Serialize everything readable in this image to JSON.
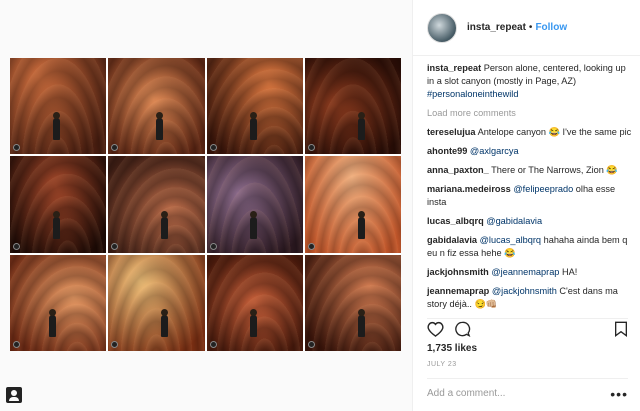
{
  "post": {
    "username": "insta_repeat",
    "dot": "•",
    "follow": "Follow",
    "caption_user": "insta_repeat",
    "caption_text": " Person alone, centered, looking up in a slot canyon (mostly in Page, AZ) ",
    "caption_tag": "#personaloneinthewild",
    "load_more": "Load more comments",
    "comments": [
      {
        "user": "tereselujua",
        "text": " Antelope canyon 😂 I've the same pic"
      },
      {
        "user": "ahonte99",
        "mention": "@axlgarcya",
        "text": ""
      },
      {
        "user": "anna_paxton_",
        "text": " There or The Narrows, Zion 😂"
      },
      {
        "user": "mariana.medeiross",
        "mention": "@felipeeprado",
        "text": " olha esse insta"
      },
      {
        "user": "lucas_albqrq",
        "mention": "@gabidalavia",
        "text": ""
      },
      {
        "user": "gabidalavia",
        "mention": "@lucas_albqrq",
        "text": " hahaha ainda bem q eu n fiz essa hehe 😂"
      },
      {
        "user": "jackjohnsmith",
        "mention": "@jeannemaprap",
        "text": " HA!"
      },
      {
        "user": "jeannemaprap",
        "mention": "@jackjohnsmith",
        "text": " C'est dans ma story déjà.. 😏👊🏼"
      }
    ],
    "likes": "1,735 likes",
    "date": "JULY 23",
    "add_comment_placeholder": "Add a comment...",
    "more_options": "•••"
  },
  "icons": [
    "heart-icon",
    "comment-icon",
    "bookmark-icon",
    "user-tag-icon"
  ],
  "tiles": [
    {
      "c1": "#c96b3c",
      "c2": "#4a1e10"
    },
    {
      "c1": "#e08a55",
      "c2": "#5a2412"
    },
    {
      "c1": "#d9763f",
      "c2": "#3a150a"
    },
    {
      "c1": "#8a3a1e",
      "c2": "#2a0d06"
    },
    {
      "c1": "#a4482a",
      "c2": "#1e0a05"
    },
    {
      "c1": "#b86a48",
      "c2": "#3d1d14"
    },
    {
      "c1": "#8a6a8a",
      "c2": "#2b1820"
    },
    {
      "c1": "#f0b080",
      "c2": "#c2562a"
    },
    {
      "c1": "#e89a64",
      "c2": "#6e2a14"
    },
    {
      "c1": "#f2c27a",
      "c2": "#7a2e12"
    },
    {
      "c1": "#c8603a",
      "c2": "#4a1a0c"
    },
    {
      "c1": "#d07a50",
      "c2": "#3a140a"
    }
  ]
}
